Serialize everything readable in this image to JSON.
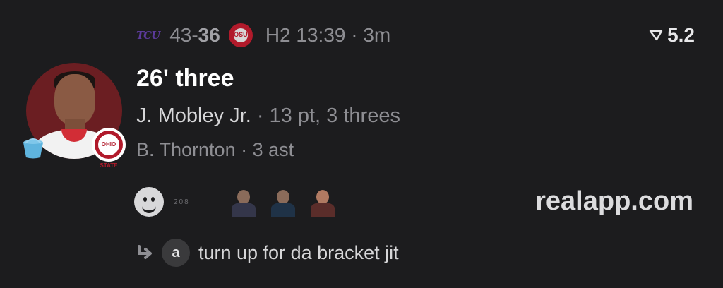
{
  "header": {
    "home_team_logo": "TCU",
    "home_score": "43",
    "separator": "-",
    "away_score": "36",
    "away_team_logo": "OSU",
    "period_clock": "H2 13:39 · 3m"
  },
  "odds": {
    "icon": "wedge-icon",
    "value": "5.2"
  },
  "play": {
    "title": "26' three",
    "player": "J. Mobley Jr.",
    "player_stat": " · 13 pt, 3 threes",
    "assist": "B. Thornton · 3 ast"
  },
  "avatar": {
    "badge_text": "OHIO STATE",
    "accent": "#b11a2b"
  },
  "reactions": {
    "count_text": "208"
  },
  "brand": "realapp.com",
  "reply": {
    "avatar_letter": "a",
    "text": "turn up for da bracket jit"
  }
}
